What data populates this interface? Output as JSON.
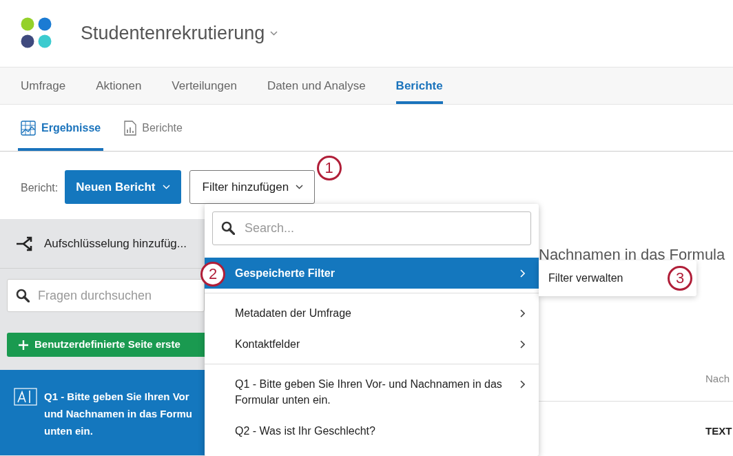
{
  "header": {
    "title": "Studentenrekrutierung"
  },
  "main_tabs": [
    {
      "label": "Umfrage",
      "selected": false
    },
    {
      "label": "Aktionen",
      "selected": false
    },
    {
      "label": "Verteilungen",
      "selected": false
    },
    {
      "label": "Daten und Analyse",
      "selected": false
    },
    {
      "label": "Berichte",
      "selected": true
    }
  ],
  "sub_tabs": [
    {
      "label": "Ergebnisse",
      "kind": "results",
      "selected": true
    },
    {
      "label": "Berichte",
      "kind": "reports",
      "selected": false
    }
  ],
  "toolbar": {
    "label": "Bericht:",
    "report_button": "Neuen Bericht",
    "filter_button": {
      "label": "Filter hinzufügen",
      "callout": "1"
    }
  },
  "sidebar": {
    "breakdown": "Aufschlüsselung hinzufüg...",
    "search": {
      "placeholder": "Fragen durchsuchen"
    },
    "custom_page_button": "Benutzerdefinierte Seite erste",
    "questions": [
      {
        "lines": [
          "Q1 - Bitte geben Sie Ihren Vor",
          "und Nachnamen in das Formu",
          "unten ein."
        ],
        "selected": true
      }
    ]
  },
  "content": {
    "heading": "Nachnamen in das Formula",
    "column_header": "Nach",
    "cell": "TEXT"
  },
  "dropdown": {
    "search": {
      "placeholder": "Search..."
    },
    "groups": [
      [
        {
          "label": "Gespeicherte Filter",
          "selected": true,
          "callout": "2"
        }
      ],
      [
        {
          "label": "Metadaten der Umfrage",
          "selected": false
        },
        {
          "label": "Kontaktfelder",
          "selected": false
        }
      ],
      [
        {
          "label": "Q1 - Bitte geben Sie Ihren Vor- und Nachnamen in das Formular unten ein.",
          "selected": false
        },
        {
          "label": "Q2 - Was ist Ihr Geschlecht?",
          "selected": false,
          "no_arrow": true
        }
      ]
    ]
  },
  "submenu": {
    "items": [
      {
        "label": "Filter verwalten",
        "callout": "3"
      }
    ]
  }
}
